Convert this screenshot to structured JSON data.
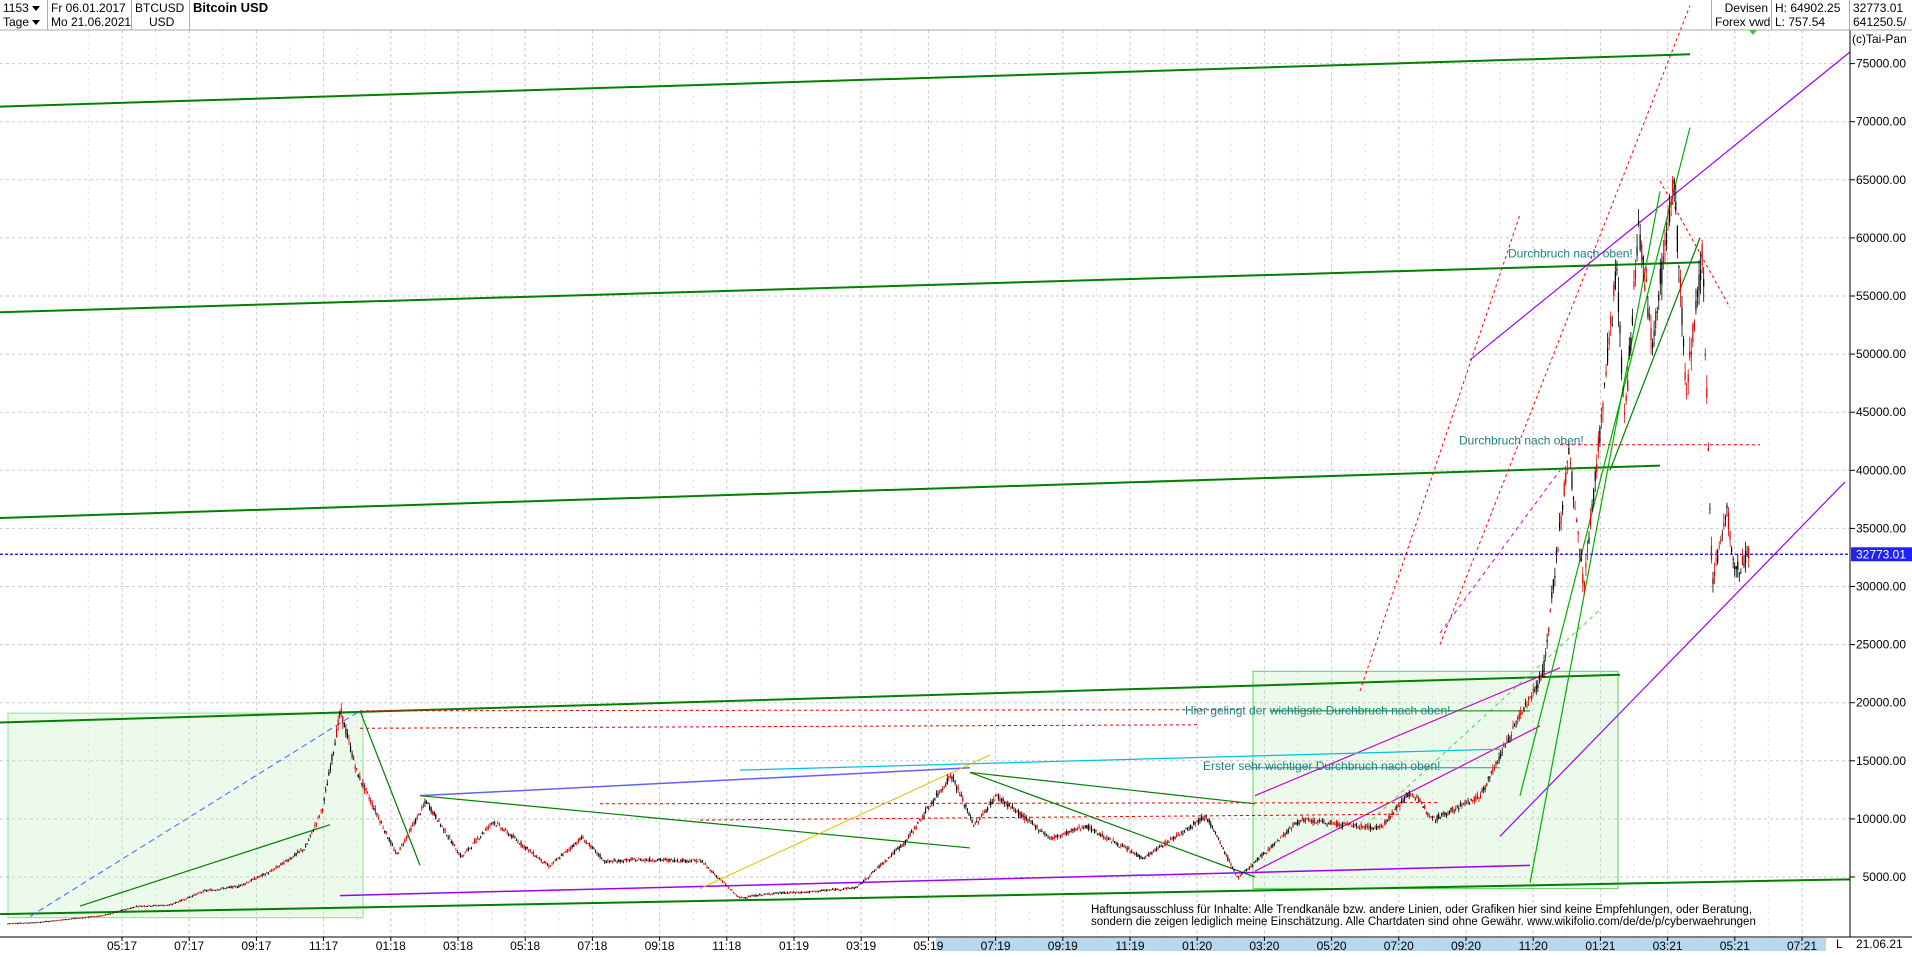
{
  "header": {
    "bars_count": "1153",
    "period": "Tage",
    "date_from": "Fr 06.01.2017",
    "date_to": "Mo 21.06.2021",
    "symbol": "BTCUSD",
    "currency": "USD",
    "title": "Bitcoin USD",
    "market": "Devisen",
    "source": "Forex vwd",
    "high_label": "H: 64902.25",
    "low_label": "L: 757.54",
    "last_value": "32773.01",
    "volume_value": "641250.5/",
    "copyright": "(c)Tai-Pan"
  },
  "annotations": {
    "breakout_top": "Durchbruch nach oben!",
    "breakout_mid": "Durchbruch nach oben!",
    "breakout_main": "Hier gelingt der wichtigste Durchbruch nach oben!",
    "breakout_first": "Erster sehr wichtiger Durchbruch nach oben!"
  },
  "disclaimer": {
    "line1": "Haftungsausschluss für Inhalte: Alle Trendkanäle bzw. andere Linien, oder Grafiken hier sind keine Empfehlungen, oder Beratung,",
    "line2": "sondern die zeigen lediglich meine  Einschätzung. Alle Chartdaten sind ohne Gewähr.  www.wikifolio.com/de/de/p/cyberwaehrungen"
  },
  "bottom_right": {
    "scale_letter": "L",
    "end_date": "21.06.21"
  },
  "colors": {
    "candle_up": "#000000",
    "candle_down": "#e00000",
    "trend_green": "#008000",
    "channel_purple": "#9b00ff",
    "price_line": "#0000cc",
    "annotation_text": "#208080"
  },
  "chart_data": {
    "type": "candlestick",
    "title": "Bitcoin USD",
    "x_tick_labels": [
      "05:17",
      "07:17",
      "09:17",
      "11:17",
      "01:18",
      "03:18",
      "05:18",
      "07:18",
      "09:18",
      "11:18",
      "01:19",
      "03:19",
      "05:19",
      "07:19",
      "09:19",
      "11:19",
      "01:20",
      "03:20",
      "05:20",
      "07:20",
      "09:20",
      "11:20",
      "01:21",
      "03:21",
      "05:21",
      "07:21"
    ],
    "y_tick_labels": [
      "5000.00",
      "10000.00",
      "15000.00",
      "20000.00",
      "25000.00",
      "30000.00",
      "35000.00",
      "40000.00",
      "45000.00",
      "50000.00",
      "55000.00",
      "60000.00",
      "65000.00",
      "70000.00",
      "75000.00"
    ],
    "y_ticks": [
      5000,
      10000,
      15000,
      20000,
      25000,
      30000,
      35000,
      40000,
      45000,
      50000,
      55000,
      60000,
      65000,
      70000,
      75000
    ],
    "ylim": [
      1500,
      78500
    ],
    "scale": "linear",
    "grid": true,
    "last_price": 32773.01,
    "last_price_label": "32773.01",
    "price_path": [
      [
        "2017-01",
        900
      ],
      [
        "2017-03",
        1100
      ],
      [
        "2017-05",
        1700
      ],
      [
        "2017-06",
        2500
      ],
      [
        "2017-07",
        2600
      ],
      [
        "2017-08",
        3800
      ],
      [
        "2017-09",
        4200
      ],
      [
        "2017-10",
        5500
      ],
      [
        "2017-11",
        7500
      ],
      [
        "2017-12-01",
        11000
      ],
      [
        "2017-12-17",
        19300
      ],
      [
        "2018-01-01",
        14000
      ],
      [
        "2018-02-06",
        6900
      ],
      [
        "2018-03-05",
        11500
      ],
      [
        "2018-04-06",
        6700
      ],
      [
        "2018-05-05",
        9800
      ],
      [
        "2018-06-25",
        5900
      ],
      [
        "2018-07-25",
        8400
      ],
      [
        "2018-08-15",
        6300
      ],
      [
        "2018-09-15",
        6500
      ],
      [
        "2018-11-10",
        6400
      ],
      [
        "2018-12-15",
        3200
      ],
      [
        "2019-01-15",
        3600
      ],
      [
        "2019-02-15",
        3700
      ],
      [
        "2019-04-01",
        4100
      ],
      [
        "2019-05-15",
        8000
      ],
      [
        "2019-06-26",
        13800
      ],
      [
        "2019-07-17",
        9400
      ],
      [
        "2019-08-06",
        12000
      ],
      [
        "2019-09-25",
        8300
      ],
      [
        "2019-10-26",
        9400
      ],
      [
        "2019-12-18",
        6600
      ],
      [
        "2020-02-13",
        10300
      ],
      [
        "2020-03-13",
        4900
      ],
      [
        "2020-05-08",
        9900
      ],
      [
        "2020-07-20",
        9200
      ],
      [
        "2020-08-17",
        12300
      ],
      [
        "2020-09-08",
        10000
      ],
      [
        "2020-10-20",
        12000
      ],
      [
        "2020-11-25",
        19000
      ],
      [
        "2020-12-16",
        22500
      ],
      [
        "2021-01-08",
        41500
      ],
      [
        "2021-01-22",
        30000
      ],
      [
        "2021-02-21",
        57500
      ],
      [
        "2021-02-28",
        44000
      ],
      [
        "2021-03-13",
        61000
      ],
      [
        "2021-03-25",
        51000
      ],
      [
        "2021-04-14",
        64900
      ],
      [
        "2021-04-25",
        47000
      ],
      [
        "2021-05-10",
        58900
      ],
      [
        "2021-05-19",
        30000
      ],
      [
        "2021-06-01",
        37000
      ],
      [
        "2021-06-08",
        31000
      ],
      [
        "2021-06-21",
        32773
      ]
    ]
  }
}
